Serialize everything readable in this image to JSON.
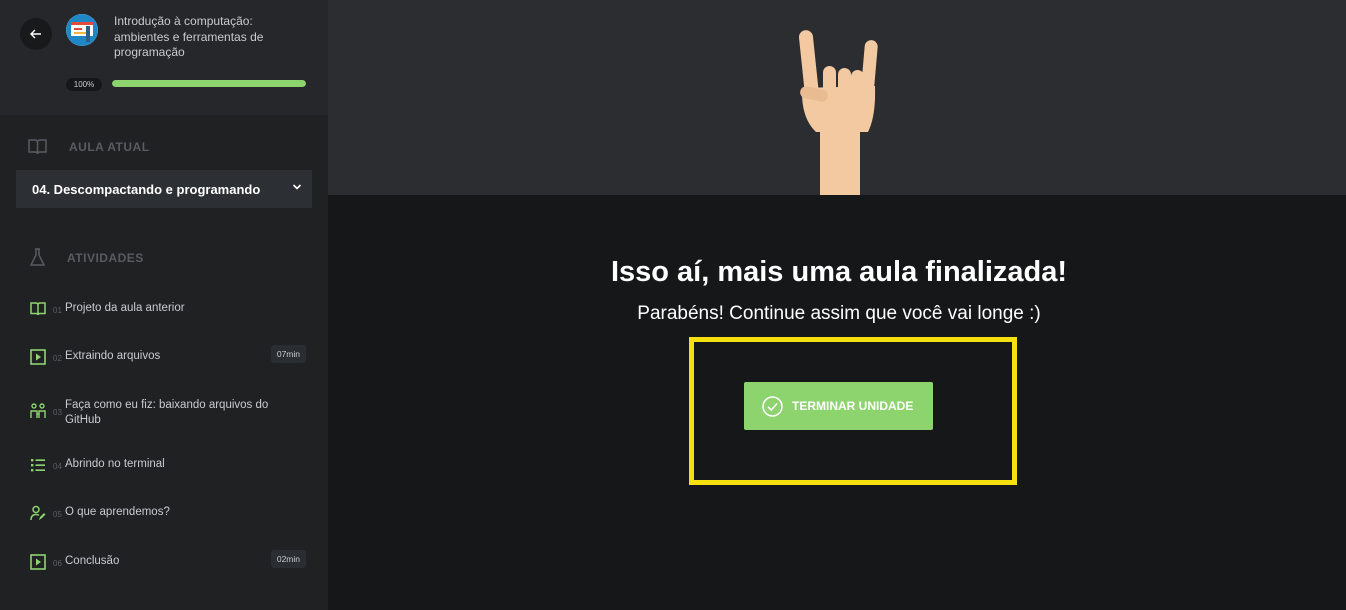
{
  "course": {
    "title": "Introdução à computação: ambientes e ferramentas de programação",
    "progress_label": "100%",
    "progress": 1.0
  },
  "current_lesson": {
    "heading": "AULA ATUAL",
    "selected": "04. Descompactando e programando"
  },
  "activities": {
    "heading": "ATIVIDADES",
    "items": [
      {
        "num": "01",
        "label": "Projeto da aula anterior",
        "duration": "",
        "icon": "book-icon"
      },
      {
        "num": "02",
        "label": "Extraindo arquivos",
        "duration": "07min",
        "icon": "video-icon"
      },
      {
        "num": "03",
        "label": "Faça como eu fiz: baixando arquivos do GitHub",
        "duration": "",
        "icon": "people-icon"
      },
      {
        "num": "04",
        "label": "Abrindo no terminal",
        "duration": "",
        "icon": "list-icon"
      },
      {
        "num": "05",
        "label": "O que aprendemos?",
        "duration": "",
        "icon": "user-edit-icon"
      },
      {
        "num": "06",
        "label": "Conclusão",
        "duration": "02min",
        "icon": "video-icon"
      }
    ]
  },
  "main": {
    "headline": "Isso aí, mais uma aula finalizada!",
    "subline": "Parabéns! Continue assim que você vai longe :)",
    "finish_button": "TERMINAR UNIDADE"
  },
  "colors": {
    "accent_green": "#8dd46f",
    "highlight_yellow": "#f7e00f",
    "sidebar_bg": "#1f2123"
  }
}
